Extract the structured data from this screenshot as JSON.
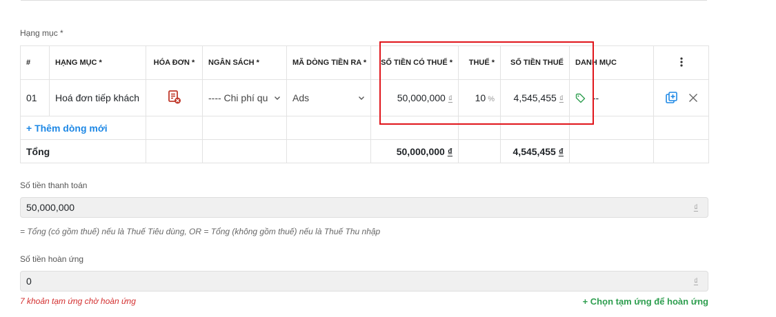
{
  "section": {
    "label": "Hạng mục *"
  },
  "table": {
    "headers": {
      "index": "#",
      "item": "HẠNG MỤC *",
      "invoice": "HÓA ĐƠN *",
      "budget": "NGÂN SÁCH *",
      "cashflow": "MÃ DÒNG TIỀN RA *",
      "amount_with_tax": "SỐ TIỀN CÓ THUẾ *",
      "tax": "THUẾ *",
      "tax_amount": "SỐ TIỀN THUẾ",
      "category": "DANH MỤC"
    },
    "row": {
      "index": "01",
      "item": "Hoá đơn tiếp khách",
      "budget": "---- Chi phí qu",
      "cashflow": "Ads",
      "amount_with_tax": "50,000,000",
      "currency": "₫",
      "tax": "10",
      "tax_unit": "%",
      "tax_amount": "4,545,455",
      "category": "--"
    },
    "add_row_label": "+ Thêm dòng mới",
    "total": {
      "label": "Tổng",
      "amount_with_tax": "50,000,000",
      "tax_amount": "4,545,455",
      "currency": "₫"
    }
  },
  "payment": {
    "label": "Số tiền thanh toán",
    "value": "50,000,000",
    "currency": "₫",
    "note": "= Tổng (có gồm thuế) nếu là Thuế Tiêu dùng, OR = Tổng (không gồm thuế) nếu là Thuế Thu nhập"
  },
  "refund": {
    "label": "Số tiền hoàn ứng",
    "value": "0",
    "currency": "₫",
    "warning": "7 khoản tạm ứng chờ hoàn ứng",
    "action": "+ Chọn tạm ứng để hoàn ứng"
  },
  "icons": {
    "invoice": "invoice-error-icon",
    "category": "tag-icon",
    "more": "more-vertical-icon",
    "duplicate": "duplicate-icon",
    "remove": "close-icon"
  },
  "colors": {
    "link_blue": "#1e88e5",
    "action_green": "#2e9e4f",
    "warning_red": "#d32f2f",
    "highlight_red": "#e0141a",
    "invoice_icon": "#c0392b"
  }
}
